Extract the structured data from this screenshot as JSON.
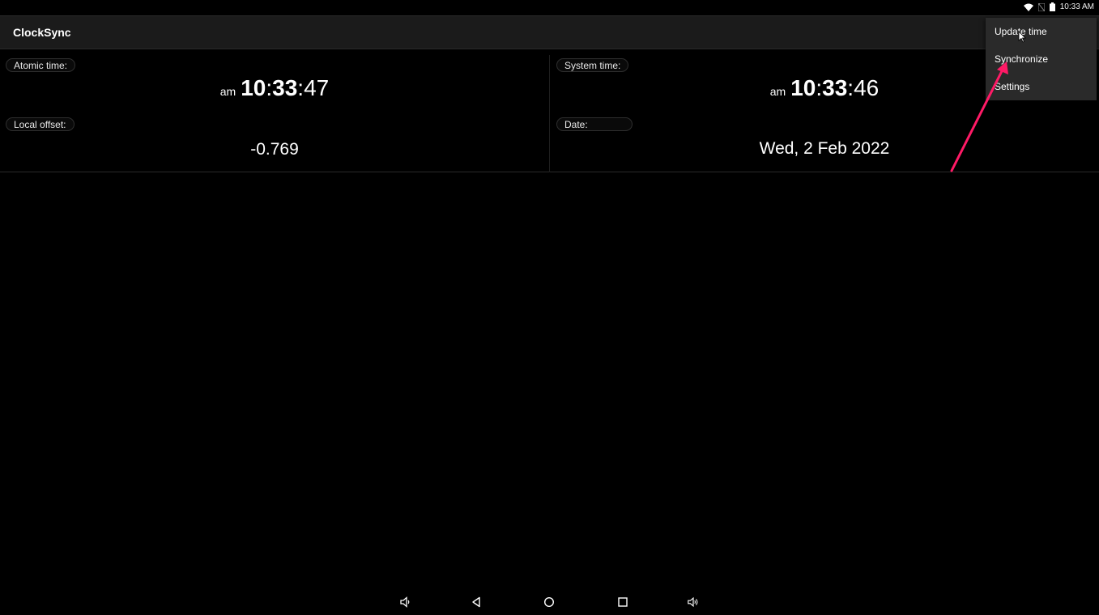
{
  "status_bar": {
    "time": "10:33 AM"
  },
  "app_bar": {
    "title": "ClockSync"
  },
  "atomic": {
    "label": "Atomic time:",
    "ampm": "am",
    "hour": "10",
    "minute": "33",
    "second": "47"
  },
  "system": {
    "label": "System time:",
    "ampm": "am",
    "hour": "10",
    "minute": "33",
    "second": "46"
  },
  "offset": {
    "label": "Local offset:",
    "value": "-0.769"
  },
  "date": {
    "label": "Date:",
    "value": "Wed, 2 Feb 2022"
  },
  "menu": {
    "items": [
      {
        "label": "Update time"
      },
      {
        "label": "Synchronize"
      },
      {
        "label": "Settings"
      }
    ]
  },
  "annotation": {
    "arrow_color": "#ff1a66"
  },
  "nav_bar": {
    "icons": [
      "volume-down-icon",
      "back-icon",
      "home-icon",
      "recents-icon",
      "volume-up-icon"
    ]
  }
}
